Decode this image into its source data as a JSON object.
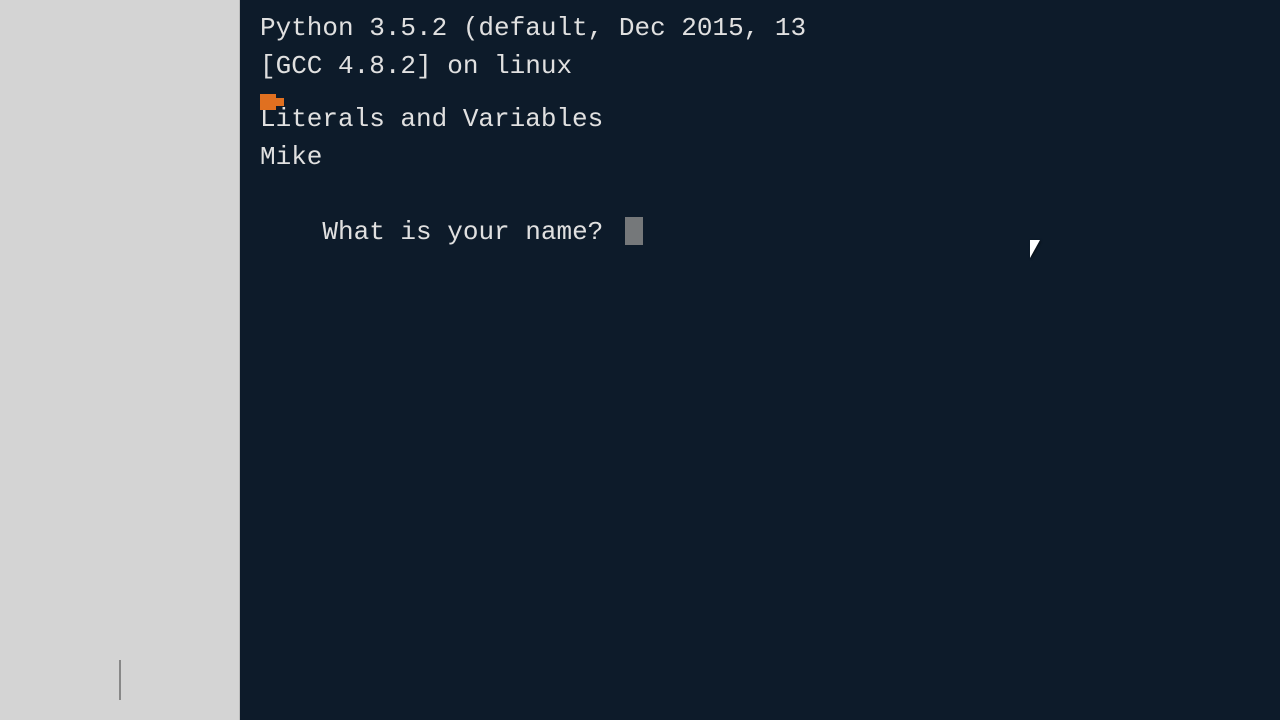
{
  "sidebar": {
    "background": "#d4d4d4"
  },
  "terminal": {
    "background": "#0d1b2a",
    "text_color": "#e0e0e0",
    "line1": "Python 3.5.2 (default, Dec 2015, 13",
    "line2": "[GCC 4.8.2] on linux",
    "line3_prefix": ">",
    "line4": "Literals and Variables",
    "line5": "Mike",
    "line6": "What is your name? "
  }
}
